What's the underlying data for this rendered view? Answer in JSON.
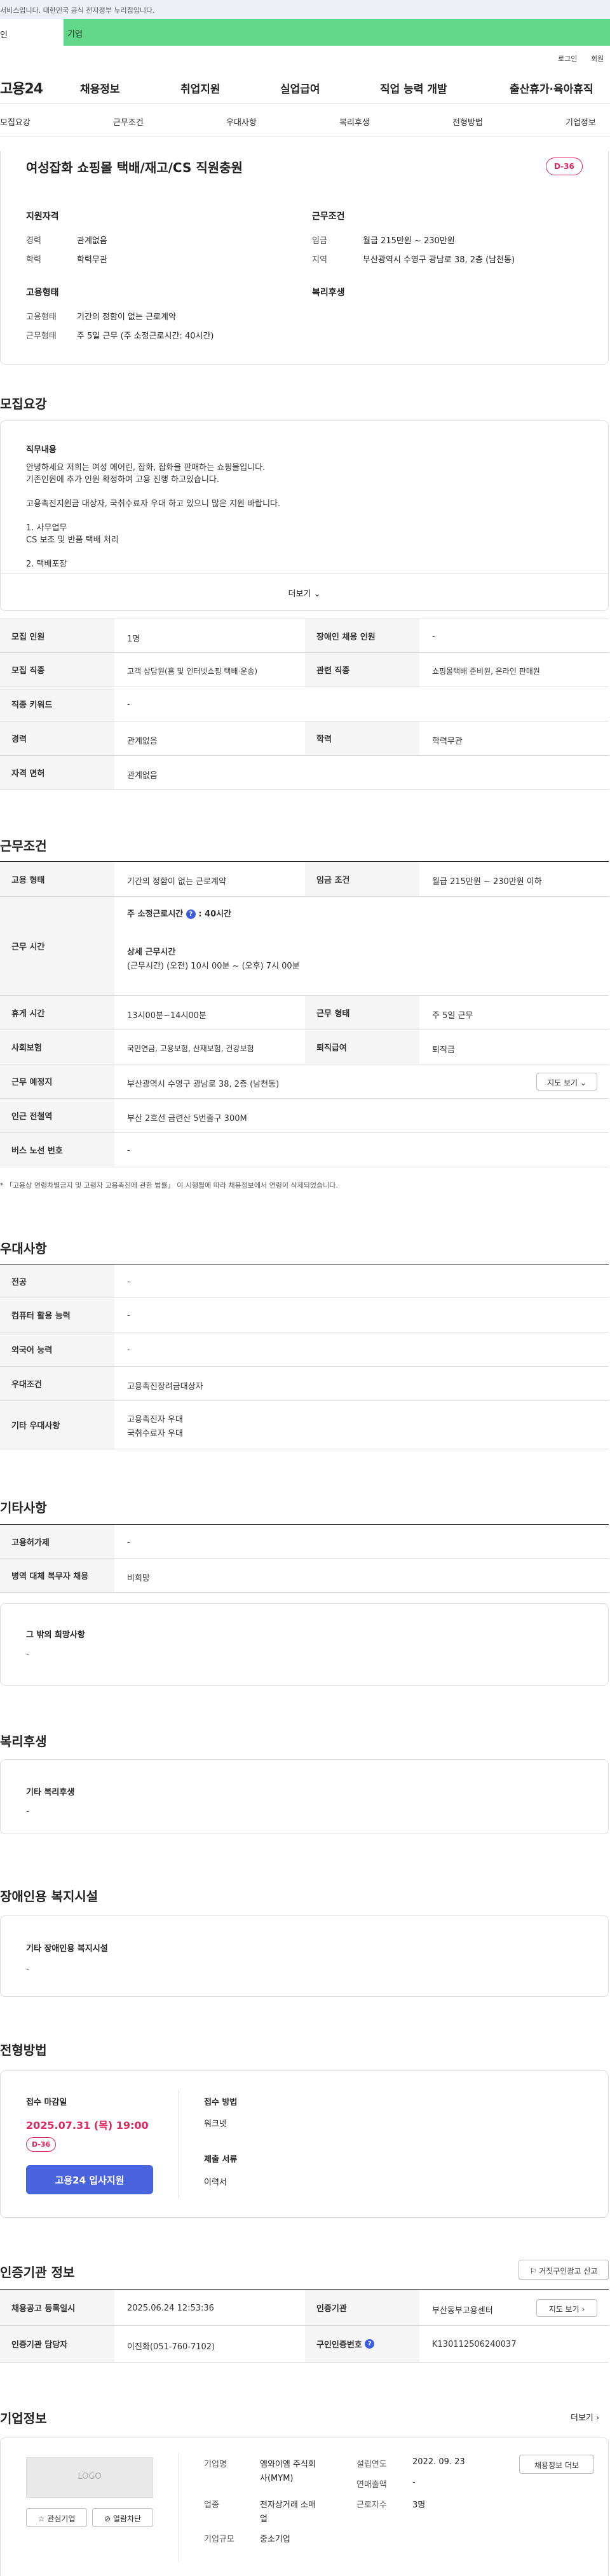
{
  "gov_banner": {
    "text": "서비스입니다. 대한민국 공식 전자정부 누리집입니다."
  },
  "top": {
    "seg1": "인",
    "seg2": "기업"
  },
  "util": {
    "login": "로그인",
    "join": "회원"
  },
  "gnb": {
    "logo": "고용24",
    "menu": [
      "채용정보",
      "취업지원",
      "실업급여",
      "직업 능력 개발",
      "출산휴가·육아휴직"
    ]
  },
  "tabs": [
    "모집요강",
    "근무조건",
    "우대사항",
    "복리후생",
    "전형방법",
    "기업정보"
  ],
  "job": {
    "title": "여성잡화 쇼핑몰 택배/재고/CS 직원충원",
    "dday": "D-36",
    "qual_title": "지원자격",
    "exp_label": "경력",
    "exp": "관계없음",
    "edu_label": "학력",
    "edu": "학력무관",
    "cond_title": "근무조건",
    "wage_label": "임금",
    "wage": "월급 215만원 ~ 230만원",
    "region_label": "지역",
    "region": "부산광역시 수영구 광남로 38, 2층 (남천동)",
    "emp_title": "고용형태",
    "welfare_title": "복리후생",
    "type_label": "고용형태",
    "type": "기간의 정함이 없는 근로계약",
    "hours_label": "근무형태",
    "hours": "주 5일 근무 (주 소정근로시간: 40시간)"
  },
  "recruit": {
    "section": "모집요강",
    "desc_title": "직무내용",
    "desc_lines": [
      "안녕하세요 저희는 여성 에어린, 잡화, 잡화을 판매하는 쇼핑몰입니다.",
      "기존인원에 추가 인원 확정하여 고용 진행 하고있습니다.",
      "",
      "고용촉진지원금 대상자, 국취수료자 우대 하고 있으니 많은 지원 바랍니다.",
      "",
      "1. 사무업무",
      "CS 보조 및 반품 택배 처리",
      "",
      "2. 택배포장"
    ],
    "more": "더보기",
    "headcount_k": "모집 인원",
    "headcount_v": "1명",
    "disabled_k": "장애인 채용 인원",
    "disabled_v": "-",
    "job_k": "모집 직종",
    "job_v": "고객 상담원(홈 및 인터넷쇼핑 택배·운송)",
    "related_k": "관련 직종",
    "related_v": "쇼핑몰택배 준비원, 온라인 판매원",
    "keyword_k": "직종 키워드",
    "keyword_v": "-",
    "career_k": "경력",
    "career_v": "관계없음",
    "edu_k": "학력",
    "edu_v": "학력무관",
    "license_k": "자격 면허",
    "license_v": "관계없음"
  },
  "work": {
    "section": "근무조건",
    "type_k": "고용 형태",
    "type_v": "기간의 정함이 없는 근로계약",
    "wage_k": "임금 조건",
    "wage_v": "월급 215만원 ~ 230만원 이하",
    "time_k": "근무 시간",
    "time_week_label": "주 소정근로시간",
    "time_week": ": 40시간",
    "time_detail_label": "상세 근무시간",
    "time_detail": "(근무시간) (오전) 10시 00분 ~ (오후) 7시 00분",
    "break_k": "휴게 시간",
    "break_v": "13시00분~14시00분",
    "form_k": "근무 형태",
    "form_v": "주 5일 근무",
    "ins_k": "사회보험",
    "ins_v": "국민연금, 고용보험, 산재보험, 건강보험",
    "pension_k": "퇴직급여",
    "pension_v": "퇴직금",
    "place_k": "근무 예정지",
    "place_v": "부산광역시 수영구 광남로 38, 2층 (남천동)",
    "map_btn": "지도 보기",
    "station_k": "인근 전철역",
    "station_v": "부산 2호선 금련산 5번출구 300M",
    "bus_k": "버스 노선 번호",
    "bus_v": "-",
    "note": "* 「고용상 연령차별금지 및 고령자 고용촉진에 관한 법률」 이 시행될에 따라 채용정보에서 연령이 삭제되었습니다."
  },
  "pref": {
    "section": "우대사항",
    "major_k": "전공",
    "major_v": "-",
    "pc_k": "컴퓨터 활용 능력",
    "pc_v": "-",
    "lang_k": "외국어 능력",
    "lang_v": "-",
    "pref_k": "우대조건",
    "pref_v": "고용촉진장려금대상자",
    "other_k": "기타 우대사항",
    "other_v1": "고용촉진자 우대",
    "other_v2": "국취수료자 우대"
  },
  "etc": {
    "section": "기타사항",
    "style_k": "고용허가제",
    "style_v": "-",
    "mil_k": "병역 대체 복무자 채용",
    "mil_v": "비희망",
    "wish_title": "그 밖의 희망사항",
    "wish_v": "-"
  },
  "welfare": {
    "section": "복리후생",
    "title": "기타 복리후생",
    "value": "-"
  },
  "disabled": {
    "section": "장애인용 복지시설",
    "title": "기타 장애인용 복지시설",
    "value": "-"
  },
  "apply": {
    "section": "전형방법",
    "deadline_label": "접수 마감일",
    "deadline": "2025.07.31 (목) 19:00",
    "dday": "D-36",
    "apply_btn": "고용24 입사지원",
    "method_label": "접수 방법",
    "method": "워크넷",
    "docs_label": "제출 서류",
    "docs": "이력서"
  },
  "cert": {
    "section": "인증기관 정보",
    "report_btn": "거짓구인광고 신고",
    "reg_k": "채용공고 등록일시",
    "reg_v": "2025.06.24 12:53:36",
    "org_k": "인증기관",
    "org_v": "부산동부고용센터",
    "contact_k": "인증기관 담당자",
    "contact_v": "이진화(051-760-7102)",
    "num_k": "구인인증번호",
    "num_v": "K130112506240037",
    "map_btn": "지도 보기"
  },
  "company": {
    "section": "기업정보",
    "more": "더보기",
    "logo": "LOGO",
    "fav_btn": "관심기업",
    "block_btn": "열람차단",
    "name_label": "기업명",
    "name_v1": "엠와이엠 주식회",
    "name_v2": "사(MYM)",
    "founded_label": "설립연도",
    "founded": "2022. 09. 23",
    "sales_label": "연매출액",
    "sales": "-",
    "ind_label": "업종",
    "ind_v1": "전자상거래 소매",
    "ind_v2": "업",
    "emp_label": "근로자수",
    "emp": "3명",
    "size_label": "기업규모",
    "size": "중소기업",
    "info_btn": "채용정보 더보"
  },
  "colors": {
    "accent": "#4a64e0",
    "dday": "#e0245e",
    "topbar": "#62d689"
  }
}
